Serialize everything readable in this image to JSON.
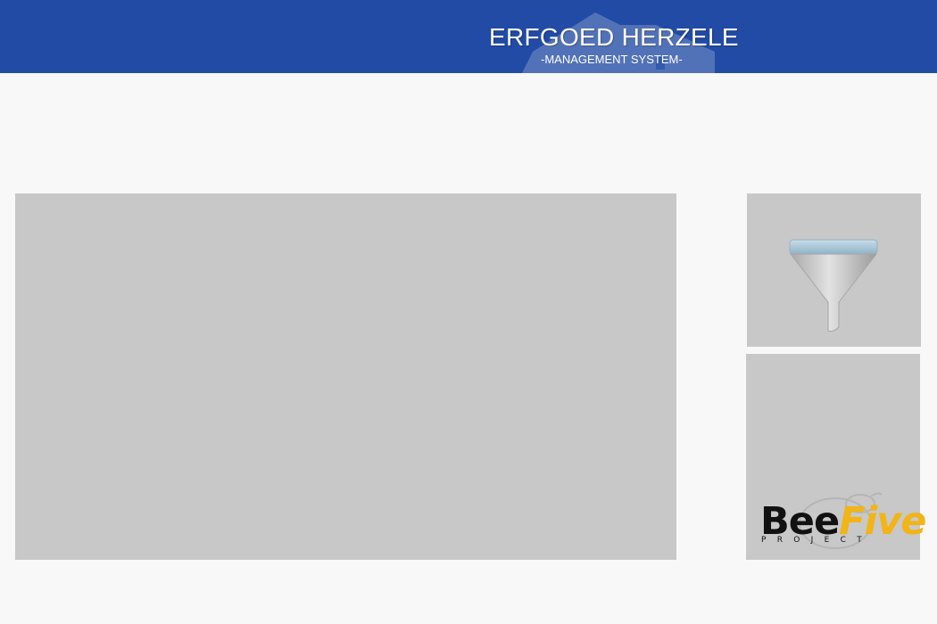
{
  "header": {
    "title": "ERFGOED HERZELE",
    "subtitle": "-MANAGEMENT SYSTEM-",
    "background_color": "#224ba5",
    "house_icon": "house-icon"
  },
  "main_panel": {
    "background_color": "#c8c8c8"
  },
  "filter_panel": {
    "icon": "filter-icon",
    "background_color": "#c8c8c8"
  },
  "logo_panel": {
    "logo": {
      "word_bee": "Bee",
      "word_five": "Five",
      "tagline": "PROJECT",
      "bee_color": "#111111",
      "five_color": "#f2b416",
      "icon": "bee-icon"
    }
  }
}
